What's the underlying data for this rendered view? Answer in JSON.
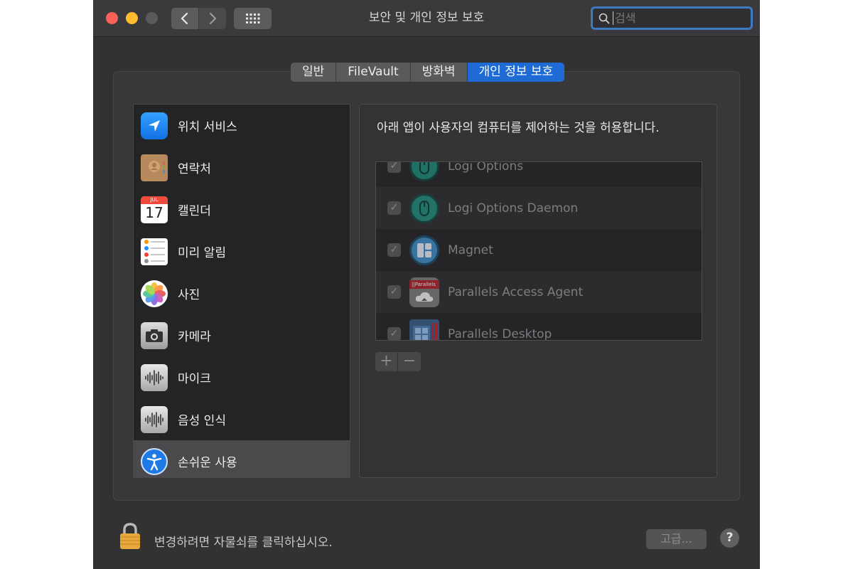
{
  "window": {
    "title": "보안 및 개인 정보 보호",
    "search_placeholder": "검색"
  },
  "tabs": [
    {
      "label": "일반",
      "active": false
    },
    {
      "label": "FileVault",
      "active": false
    },
    {
      "label": "방화벽",
      "active": false
    },
    {
      "label": "개인 정보 보호",
      "active": true
    }
  ],
  "sidebar": {
    "items": [
      {
        "label": "위치 서비스",
        "icon": "location-arrow-icon"
      },
      {
        "label": "연락처",
        "icon": "contacts-icon"
      },
      {
        "label": "캘린더",
        "icon": "calendar-icon",
        "month": "JUL",
        "day": "17"
      },
      {
        "label": "미리 알림",
        "icon": "reminders-icon"
      },
      {
        "label": "사진",
        "icon": "photos-icon"
      },
      {
        "label": "카메라",
        "icon": "camera-icon"
      },
      {
        "label": "마이크",
        "icon": "microphone-waveform-icon"
      },
      {
        "label": "음성 인식",
        "icon": "speech-recognition-waveform-icon"
      },
      {
        "label": "손쉬운 사용",
        "icon": "accessibility-icon",
        "selected": true
      }
    ]
  },
  "content": {
    "description": "아래 앱이 사용자의 컴퓨터를 제어하는 것을 허용합니다.",
    "apps": [
      {
        "name": "Logi Options",
        "checked": true,
        "icon": "logi-mouse-icon"
      },
      {
        "name": "Logi Options Daemon",
        "checked": true,
        "icon": "logi-mouse-icon"
      },
      {
        "name": "Magnet",
        "checked": true,
        "icon": "magnet-icon"
      },
      {
        "name": "Parallels Access Agent",
        "checked": true,
        "icon": "parallels-access-icon",
        "badge": "||Parallels"
      },
      {
        "name": "Parallels Desktop",
        "checked": true,
        "icon": "parallels-desktop-icon"
      }
    ],
    "add_label": "+",
    "remove_label": "−"
  },
  "footer": {
    "lock_text": "변경하려면 자물쇠를 클릭하십시오.",
    "advanced_label": "고급...",
    "help_label": "?"
  },
  "colors": {
    "accent": "#1f6bd6",
    "close": "#fe5f57",
    "minimize": "#febc2e"
  }
}
